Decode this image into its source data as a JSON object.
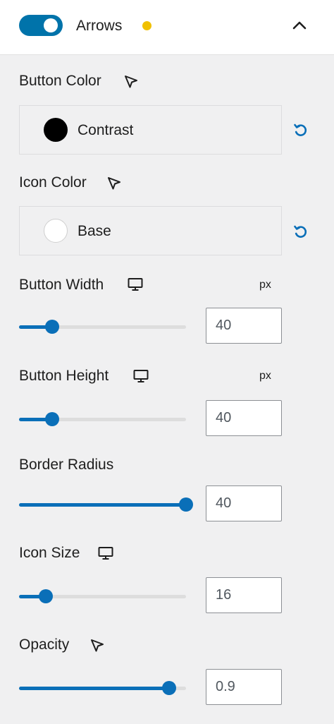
{
  "header": {
    "title": "Arrows",
    "toggle_on": true,
    "status_color": "#f0c000"
  },
  "colors": {
    "accent": "#0a6fb8",
    "toggle": "#0073aa"
  },
  "button_color": {
    "label": "Button Color",
    "value": "Contrast",
    "swatch": "#000000",
    "icon": "pointer-cursor-icon"
  },
  "icon_color": {
    "label": "Icon Color",
    "value": "Base",
    "swatch": "#ffffff",
    "icon": "pointer-cursor-icon"
  },
  "button_width": {
    "label": "Button Width",
    "unit": "px",
    "value": "40",
    "level": 0.2,
    "icon": "desktop-icon"
  },
  "button_height": {
    "label": "Button Height",
    "unit": "px",
    "value": "40",
    "level": 0.2,
    "icon": "desktop-icon"
  },
  "border_radius": {
    "label": "Border Radius",
    "value": "40",
    "level": 1.0
  },
  "icon_size": {
    "label": "Icon Size",
    "value": "16",
    "level": 0.16,
    "icon": "desktop-icon"
  },
  "opacity": {
    "label": "Opacity",
    "value": "0.9",
    "level": 0.9,
    "icon": "pointer-cursor-icon"
  }
}
